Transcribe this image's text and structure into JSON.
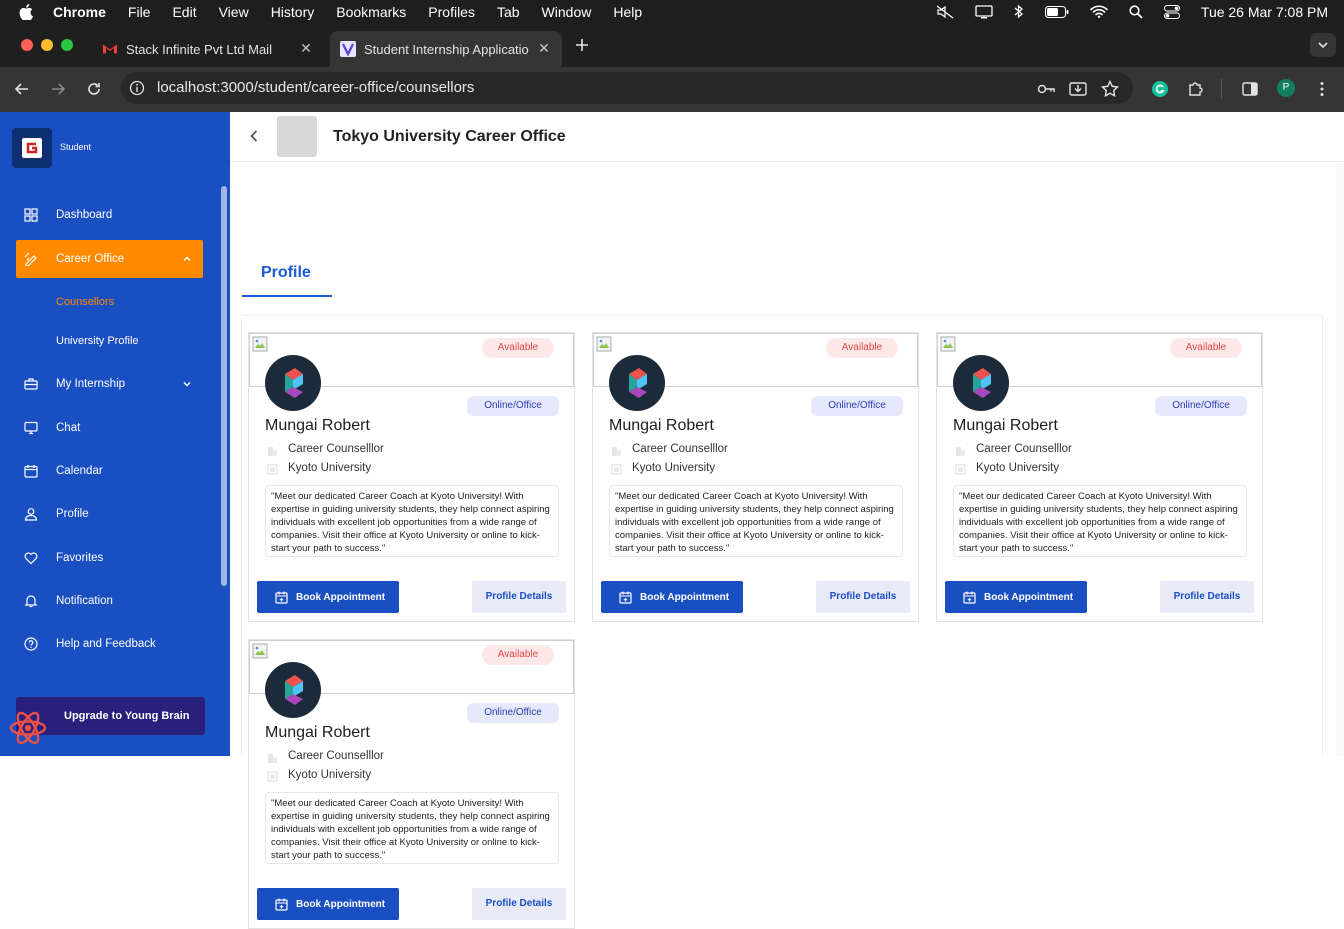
{
  "menubar": {
    "app": "Chrome",
    "items": [
      "File",
      "Edit",
      "View",
      "History",
      "Bookmarks",
      "Profiles",
      "Tab",
      "Window",
      "Help"
    ],
    "clock": "Tue 26 Mar  7:08 PM"
  },
  "browser": {
    "tabs": [
      {
        "title": "Stack Infinite Pvt Ltd Mail",
        "icon": "gmail-icon"
      },
      {
        "title": "Student Internship Applicatio",
        "icon": "app-favicon"
      }
    ],
    "url": "localhost:3000/student/career-office/counsellors",
    "profile_initial": "P"
  },
  "sidebar": {
    "role": "Student",
    "nav": [
      {
        "label": "Dashboard",
        "icon": "grid-icon"
      },
      {
        "label": "Career Office",
        "icon": "career-icon"
      },
      {
        "label": "My Internship",
        "icon": "briefcase-icon"
      },
      {
        "label": "Chat",
        "icon": "monitor-icon"
      },
      {
        "label": "Calendar",
        "icon": "calendar-icon"
      },
      {
        "label": "Profile",
        "icon": "user-icon"
      },
      {
        "label": "Favorites",
        "icon": "heart-icon"
      },
      {
        "label": "Notification",
        "icon": "bell-icon"
      },
      {
        "label": "Help and Feedback",
        "icon": "help-icon"
      }
    ],
    "subnav": [
      "Counsellors",
      "University Profile"
    ],
    "upgrade": "Upgrade to Young Brain",
    "colors": {
      "bg": "#1a4fc2",
      "active": "#ff8a00"
    }
  },
  "header": {
    "title": "Tokyo University Career Office"
  },
  "tabs": {
    "active": "Profile"
  },
  "cards": [
    {
      "status": "Available",
      "mode": "Online/Office",
      "name": "Mungai Robert",
      "role": "Career Counselllor",
      "university": "Kyoto University",
      "bio": "\"Meet our dedicated Career Coach at Kyoto University! With expertise in guiding university students, they help connect aspiring individuals with excellent job opportunities from a wide range of companies. Visit their office at Kyoto University or online to kick-start your path to success.\"",
      "book_label": "Book Appointment",
      "details_label": "Profile Details"
    },
    {
      "status": "Available",
      "mode": "Online/Office",
      "name": "Mungai Robert",
      "role": "Career Counselllor",
      "university": "Kyoto University",
      "bio": "\"Meet our dedicated Career Coach at Kyoto University! With expertise in guiding university students, they help connect aspiring individuals with excellent job opportunities from a wide range of companies. Visit their office at Kyoto University or online to kick-start your path to success.\"",
      "book_label": "Book Appointment",
      "details_label": "Profile Details"
    },
    {
      "status": "Available",
      "mode": "Online/Office",
      "name": "Mungai Robert",
      "role": "Career Counselllor",
      "university": "Kyoto University",
      "bio": "\"Meet our dedicated Career Coach at Kyoto University! With expertise in guiding university students, they help connect aspiring individuals with excellent job opportunities from a wide range of companies. Visit their office at Kyoto University or online to kick-start your path to success.\"",
      "book_label": "Book Appointment",
      "details_label": "Profile Details"
    },
    {
      "status": "Available",
      "mode": "Online/Office",
      "name": "Mungai Robert",
      "role": "Career Counselllor",
      "university": "Kyoto University",
      "bio": "\"Meet our dedicated Career Coach at Kyoto University! With expertise in guiding university students, they help connect aspiring individuals with excellent job opportunities from a wide range of companies. Visit their office at Kyoto University or online to kick-start your path to success.\"",
      "book_label": "Book Appointment",
      "details_label": "Profile Details"
    }
  ]
}
